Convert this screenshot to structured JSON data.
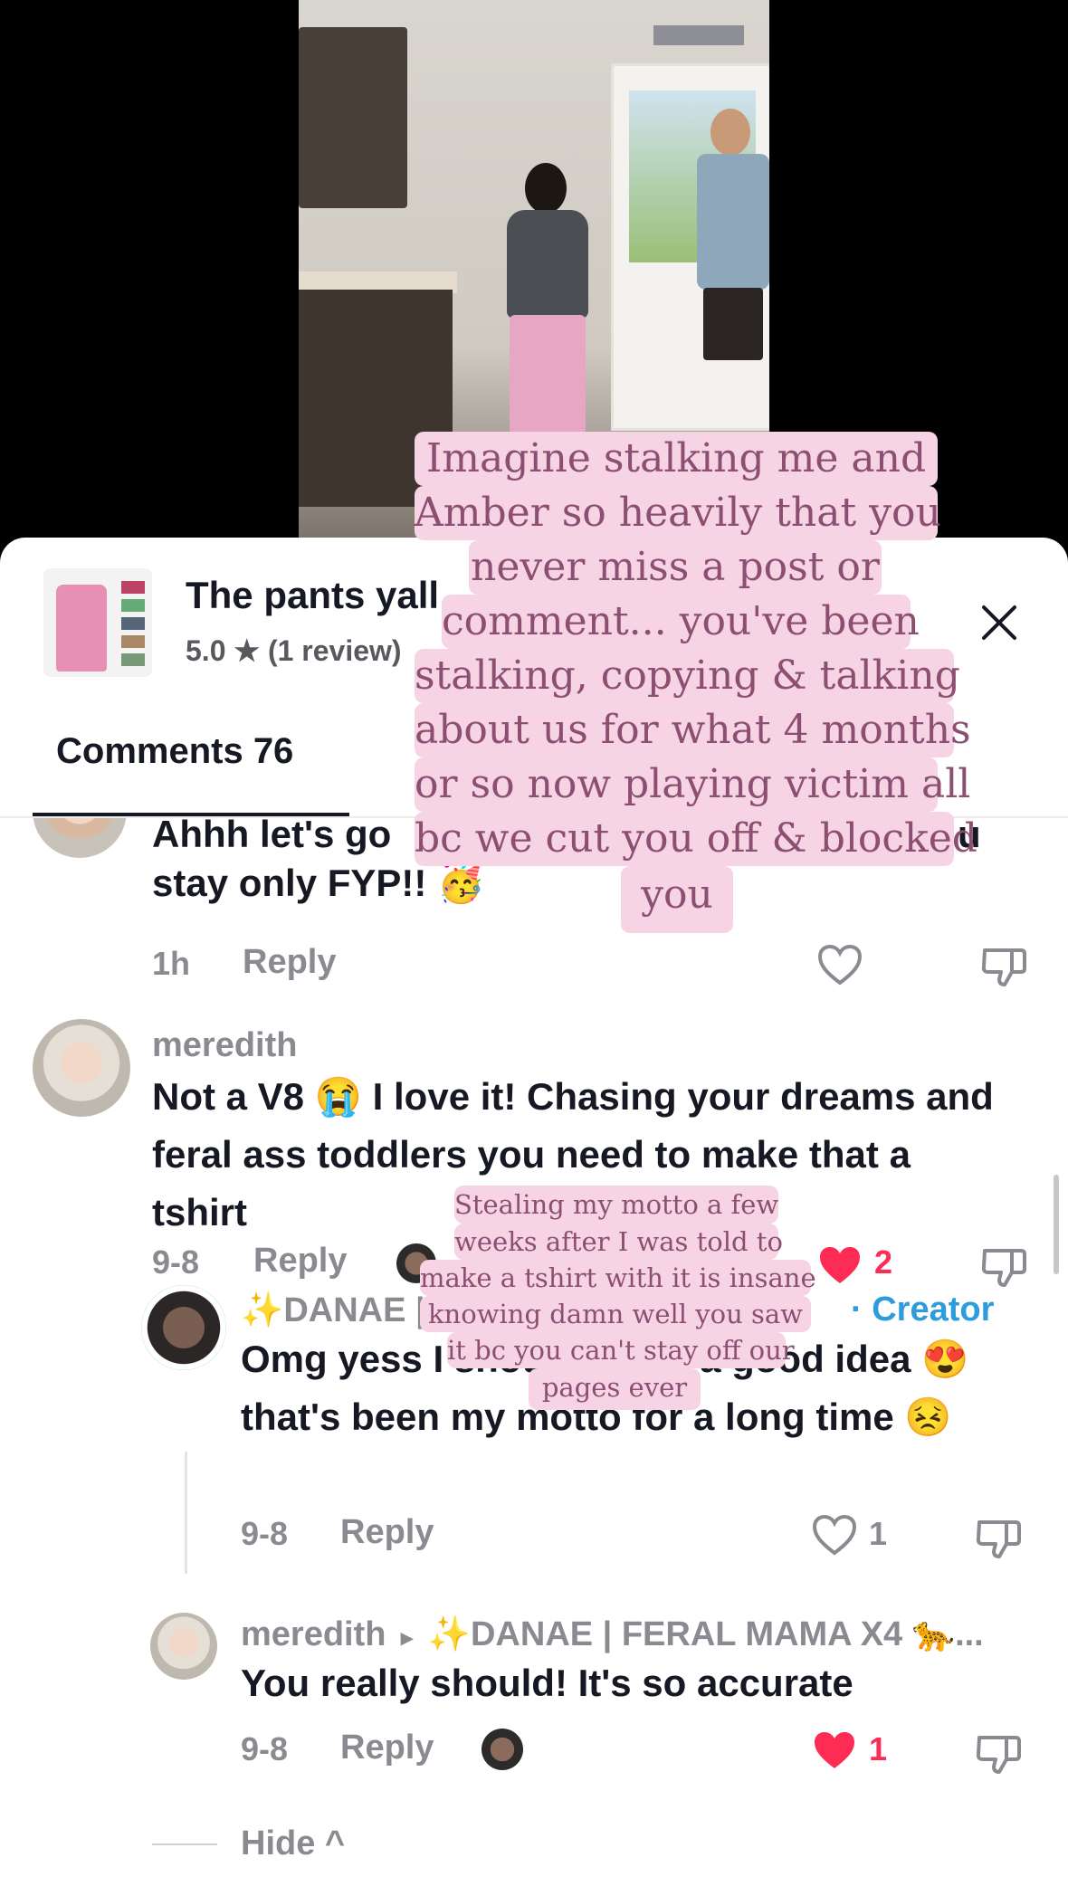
{
  "product": {
    "title": "The pants yall",
    "rating": "5.0 ★ (1 review)"
  },
  "tabs": {
    "comments_label": "Comments 76"
  },
  "comments": {
    "c0": {
      "text_line1": "Ahhh let's go",
      "text_line1_end": "u",
      "text_line2": "stay only FYP!! 🥳",
      "time": "1h",
      "reply": "Reply"
    },
    "c1": {
      "user": "meredith",
      "text": "Not a V8 😭 I love it! Chasing your dreams and feral ass toddlers you need to make that a tshirt",
      "time": "9-8",
      "reply": "Reply",
      "likes": "2"
    },
    "c2": {
      "user": "✨DANAE | FERAL MAMA X4 🐆...",
      "creator_tag": "· Creator",
      "text": "Omg yess I should that's a good idea 😍 that's been my motto for a long time 😣",
      "time": "9-8",
      "reply": "Reply",
      "likes": "1"
    },
    "c3": {
      "user": "meredith",
      "arrow": "▸",
      "reply_to": "✨DANAE | FERAL MAMA X4 🐆...",
      "text": "You really should! It's so accurate",
      "time": "9-8",
      "reply": "Reply",
      "likes": "1"
    },
    "hide_label": "Hide ^"
  },
  "overlay1": {
    "lines": [
      "Imagine stalking me and",
      "Amber so heavily that you",
      "never miss a post or",
      "comment... you've been",
      "stalking, copying & talking",
      "about us for what 4 months",
      "or so now playing victim all",
      "bc we cut you off & blocked",
      "you"
    ]
  },
  "overlay2": {
    "lines": [
      "Stealing my motto a few",
      "weeks after I was told to",
      "make a tshirt with it is insane",
      "knowing damn well you saw",
      "it bc you can't stay off our",
      "pages ever"
    ]
  },
  "colors": {
    "accent_red": "#fe2c55",
    "creator_blue": "#2d9cdb",
    "overlay_pink": "#f7d4e3"
  },
  "icons": [
    "close-icon",
    "heart-outline-icon",
    "heart-filled-icon",
    "dislike-icon",
    "reply-arrow-icon"
  ]
}
